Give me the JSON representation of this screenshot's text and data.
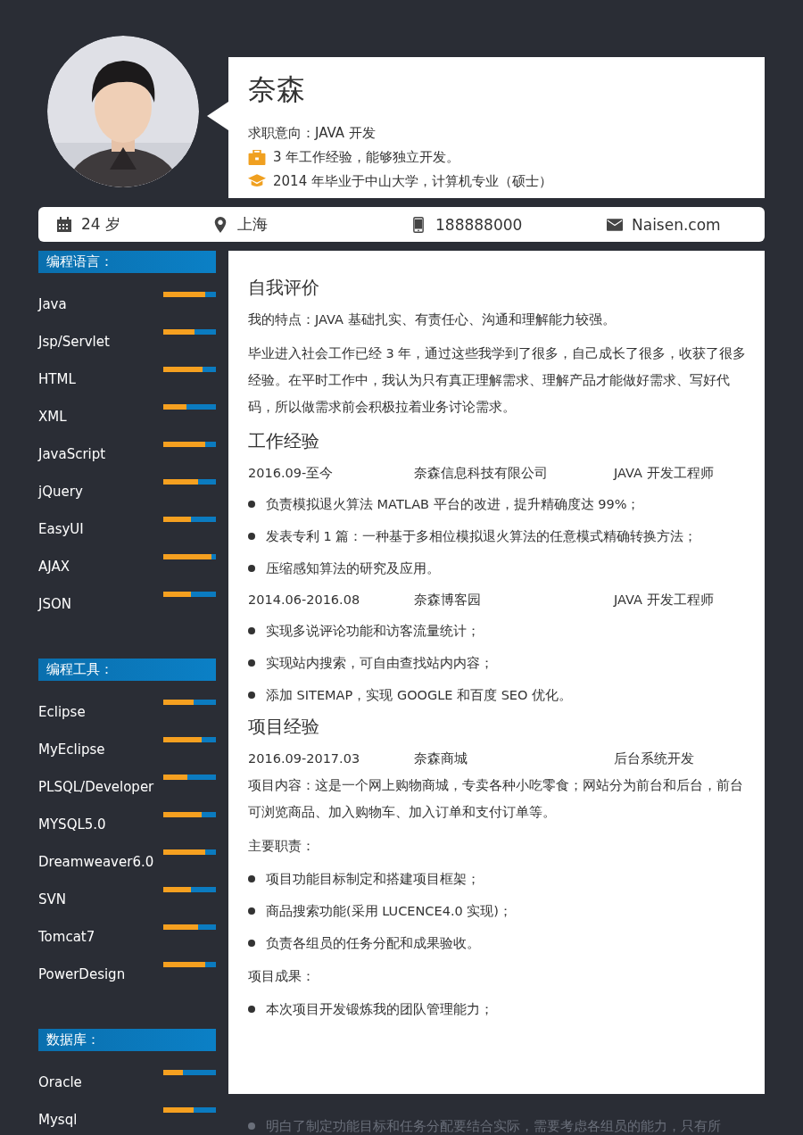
{
  "profile": {
    "name": "奈森",
    "intent": "求职意向：JAVA 开发",
    "highlights": [
      {
        "kind": "experience",
        "text": "3 年工作经验，能够独立开发。"
      },
      {
        "kind": "education",
        "text": "2014 年毕业于中山大学，计算机专业（硕士）"
      }
    ]
  },
  "contact": [
    {
      "kind": "age",
      "text": "24 岁"
    },
    {
      "kind": "location",
      "text": "上海"
    },
    {
      "kind": "phone",
      "text": "188888000"
    },
    {
      "kind": "email",
      "text": "Naisen.com"
    }
  ],
  "skill_sections": [
    {
      "title": "编程语言：",
      "items": [
        {
          "name": "Java",
          "level": 0.8
        },
        {
          "name": "Jsp/Servlet",
          "level": 0.6
        },
        {
          "name": "HTML",
          "level": 0.74
        },
        {
          "name": "XML",
          "level": 0.44
        },
        {
          "name": "JavaScript",
          "level": 0.8
        },
        {
          "name": "jQuery",
          "level": 0.66
        },
        {
          "name": "EasyUI",
          "level": 0.52
        },
        {
          "name": "AJAX",
          "level": 0.92
        },
        {
          "name": "JSON",
          "level": 0.52
        }
      ]
    },
    {
      "title": "编程工具：",
      "items": [
        {
          "name": "Eclipse",
          "level": 0.58
        },
        {
          "name": "MyEclipse",
          "level": 0.73
        },
        {
          "name": "PLSQL/Developer",
          "level": 0.45
        },
        {
          "name": "MYSQL5.0",
          "level": 0.73
        },
        {
          "name": "Dreamweaver6.0",
          "level": 0.8
        },
        {
          "name": "SVN",
          "level": 0.52
        },
        {
          "name": "Tomcat7",
          "level": 0.66
        },
        {
          "name": "PowerDesign",
          "level": 0.8
        }
      ]
    },
    {
      "title": "数据库：",
      "items": [
        {
          "name": "Oracle",
          "level": 0.37
        },
        {
          "name": "Mysql",
          "level": 0.58
        }
      ]
    }
  ],
  "self_evaluation": {
    "title": "自我评价",
    "paragraphs": [
      "我的特点：JAVA 基础扎实、有责任心、沟通和理解能力较强。",
      "毕业进入社会工作已经 3 年，通过这些我学到了很多，自己成长了很多，收获了很多经验。在平时工作中，我认为只有真正理解需求、理解产品才能做好需求、写好代码，所以做需求前会积极拉着业务讨论需求。"
    ]
  },
  "work_experience": {
    "title": "工作经验",
    "jobs": [
      {
        "period": "2016.09-至今",
        "company": "奈森信息科技有限公司",
        "role": "JAVA 开发工程师",
        "bullets": [
          "负责模拟退火算法 MATLAB 平台的改进，提升精确度达 99%；",
          "发表专利 1 篇：一种基于多相位模拟退火算法的任意模式精确转换方法；",
          "压缩感知算法的研究及应用。"
        ]
      },
      {
        "period": "2014.06-2016.08",
        "company": "奈森博客园",
        "role": "JAVA 开发工程师",
        "bullets": [
          "实现多说评论功能和访客流量统计；",
          "实现站内搜索，可自由查找站内内容；",
          "添加 SITEMAP，实现 GOOGLE  和百度 SEO 优化。"
        ]
      }
    ]
  },
  "projects": {
    "title": "项目经验",
    "items": [
      {
        "period": "2016.09-2017.03",
        "name": "奈森商城",
        "role": "后台系统开发",
        "content": "项目内容：这是一个网上购物商城，专卖各种小吃零食；网站分为前台和后台，前台可浏览商品、加入购物车、加入订单和支付订单等。",
        "duties_title": "主要职责：",
        "duties": [
          "项目功能目标制定和搭建项目框架；",
          "商品搜索功能(采用 LUCENCE4.0 实现)；",
          "负责各组员的任务分配和成果验收。"
        ],
        "results_title": "项目成果：",
        "results": [
          "本次项目开发锻炼我的团队管理能力；",
          "明白了制定功能目标和任务分配要结合实际，需要考虑各组员的能力，只有所"
        ]
      }
    ]
  }
}
